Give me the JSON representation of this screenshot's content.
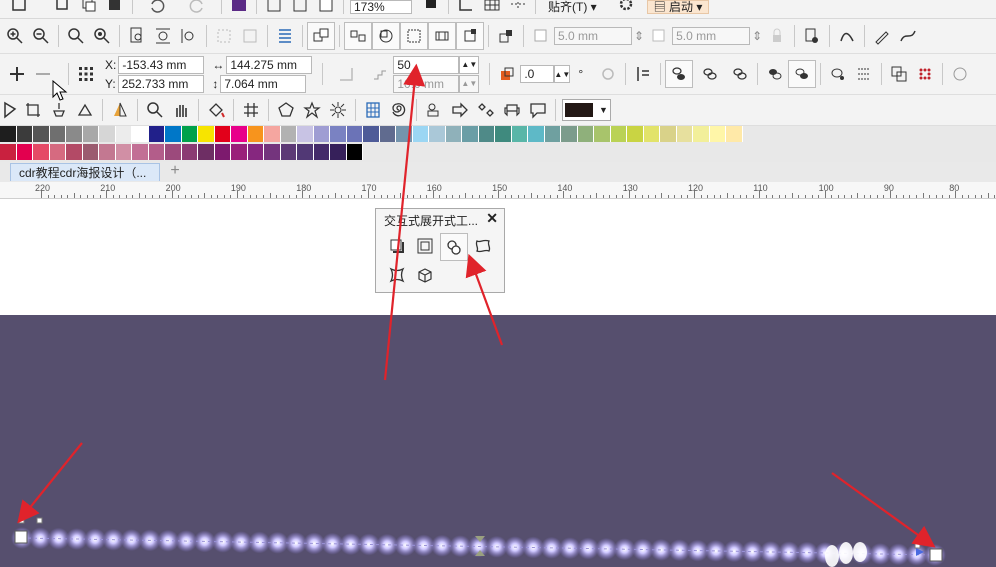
{
  "toolbar_top": {
    "zoom_value": "173%",
    "snap_label": "贴齐(T)",
    "launch_label": "启动"
  },
  "toolbar_main": {
    "nudge1": "5.0 mm",
    "nudge2": "5.0 mm"
  },
  "property_bar": {
    "x_label": "X:",
    "x_value": "-153.43 mm",
    "y_label": "Y:",
    "y_value": "252.733 mm",
    "w_value": "144.275 mm",
    "h_value": "7.064 mm",
    "steps_value": "50",
    "offset_value": "10.0 mm",
    "angle_value": ".0",
    "degree_symbol": "°"
  },
  "document_tab": {
    "title": "cdr教程cdr海报设计（..."
  },
  "ruler": {
    "ticks": [
      "220",
      "210",
      "200",
      "190",
      "180",
      "170",
      "160",
      "150",
      "140",
      "130",
      "120",
      "110",
      "100",
      "90",
      "80"
    ]
  },
  "flyout": {
    "title": "交互式展开式工...",
    "close": "✕"
  },
  "palette": {
    "row1": [
      "#1e1e1e",
      "#3b3b3b",
      "#555555",
      "#6f6f6f",
      "#8a8a8a",
      "#a8a8a8",
      "#d6d6d6",
      "#ececec",
      "#ffffff",
      "#21208a",
      "#0077c8",
      "#00a14b",
      "#f7e400",
      "#e2001a",
      "#e8008a",
      "#f7941d",
      "#f5a6a0",
      "#b2b2b2",
      "#c8c3e4",
      "#9f9dd3",
      "#7a82c2",
      "#6b73b7",
      "#4e5b98",
      "#606b8f",
      "#7494ad",
      "#9bd6f3",
      "#aac8d8",
      "#8fb1ba",
      "#6a9ea6",
      "#4f8a88",
      "#3f8a7e",
      "#59b6a8",
      "#5eb9c7",
      "#6fa0a0",
      "#7c9c8c",
      "#8fb07b",
      "#a8c46b",
      "#bad255",
      "#c9d443",
      "#e2e36a",
      "#d9d289",
      "#e7e09e",
      "#f2ef9a",
      "#fff6a8",
      "#ffe9a8"
    ],
    "row2": [
      "#c9213f",
      "#e3004f",
      "#e54a66",
      "#d66a80",
      "#b34a66",
      "#9b5b6f",
      "#c37891",
      "#d18fa5",
      "#c26f95",
      "#b35d8a",
      "#9c4a7c",
      "#8b3b73",
      "#6e2e64",
      "#7d1a6e",
      "#9a1f7a",
      "#86277f",
      "#74347d",
      "#5d3a76",
      "#513875",
      "#442a6a",
      "#36205a",
      "#000000"
    ]
  },
  "colors": {
    "dark_canvas": "#564f6e",
    "accent_purple": "#8d7fe0",
    "arrow_red": "#e0232b",
    "fill_swatch": "#231815"
  }
}
